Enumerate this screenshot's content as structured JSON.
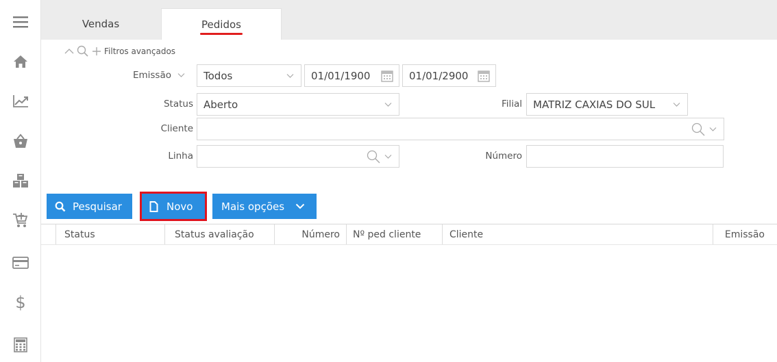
{
  "tabs": [
    {
      "label": "Vendas",
      "active": false
    },
    {
      "label": "Pedidos",
      "active": true
    }
  ],
  "filters": {
    "advanced_label": "Filtros avançados",
    "emissao": {
      "label": "Emissão",
      "period": "Todos",
      "date_from": "01/01/1900",
      "date_to": "01/01/2900"
    },
    "status": {
      "label": "Status",
      "value": "Aberto"
    },
    "filial": {
      "label": "Filial",
      "value": "MATRIZ CAXIAS DO SUL"
    },
    "cliente": {
      "label": "Cliente",
      "value": ""
    },
    "linha": {
      "label": "Linha",
      "value": ""
    },
    "numero": {
      "label": "Número",
      "value": ""
    }
  },
  "toolbar": {
    "search_label": "Pesquisar",
    "new_label": "Novo",
    "more_label": "Mais opções"
  },
  "grid": {
    "columns": [
      "Status",
      "Status avaliação",
      "Número",
      "Nº ped cliente",
      "Cliente",
      "Emissão"
    ]
  },
  "sidebar": {
    "items": [
      "menu-icon",
      "home-icon",
      "chart-icon",
      "basket-icon",
      "boxes-icon",
      "cart-add-icon",
      "card-icon",
      "dollar-icon",
      "calculator-icon"
    ]
  },
  "colors": {
    "accent": "#2a8ee0",
    "highlight": "#e0141e",
    "icon": "#8a8a8a"
  }
}
